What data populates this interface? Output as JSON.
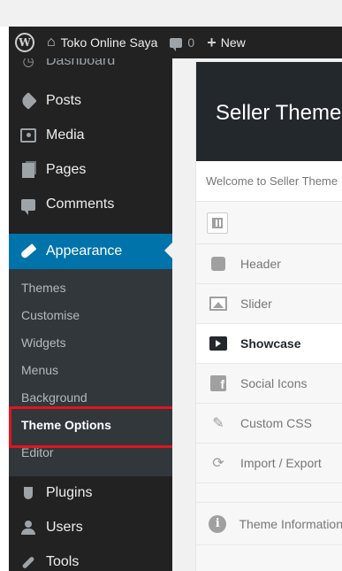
{
  "adminbar": {
    "wp_icon": "wordpress-logo-icon",
    "site_name": "Toko Online Saya",
    "comments_count": "0",
    "new_label": "New"
  },
  "sidebar": {
    "cutoff_label": "Dashboard",
    "items": [
      {
        "label": "Posts",
        "icon": "pin-icon"
      },
      {
        "label": "Media",
        "icon": "media-icon"
      },
      {
        "label": "Pages",
        "icon": "pages-icon"
      },
      {
        "label": "Comments",
        "icon": "comment-icon"
      },
      {
        "label": "Appearance",
        "icon": "paintbrush-icon"
      },
      {
        "label": "Plugins",
        "icon": "plugin-icon"
      },
      {
        "label": "Users",
        "icon": "user-icon"
      },
      {
        "label": "Tools",
        "icon": "wrench-icon"
      }
    ],
    "submenu": [
      "Themes",
      "Customise",
      "Widgets",
      "Menus",
      "Background",
      "Theme Options",
      "Editor"
    ],
    "accent_color": "#0073aa",
    "highlight_color": "#e0151f"
  },
  "main": {
    "title": "Seller Theme",
    "welcome": "Welcome to Seller Theme",
    "options": [
      {
        "label": "Header",
        "icon": "puzzle-icon"
      },
      {
        "label": "Slider",
        "icon": "image-icon"
      },
      {
        "label": "Showcase",
        "icon": "video-icon"
      },
      {
        "label": "Social Icons",
        "icon": "facebook-icon"
      },
      {
        "label": "Custom CSS",
        "icon": "brush-icon"
      },
      {
        "label": "Import / Export",
        "icon": "refresh-icon"
      },
      {
        "label": "Theme Information",
        "icon": "info-icon"
      }
    ]
  }
}
